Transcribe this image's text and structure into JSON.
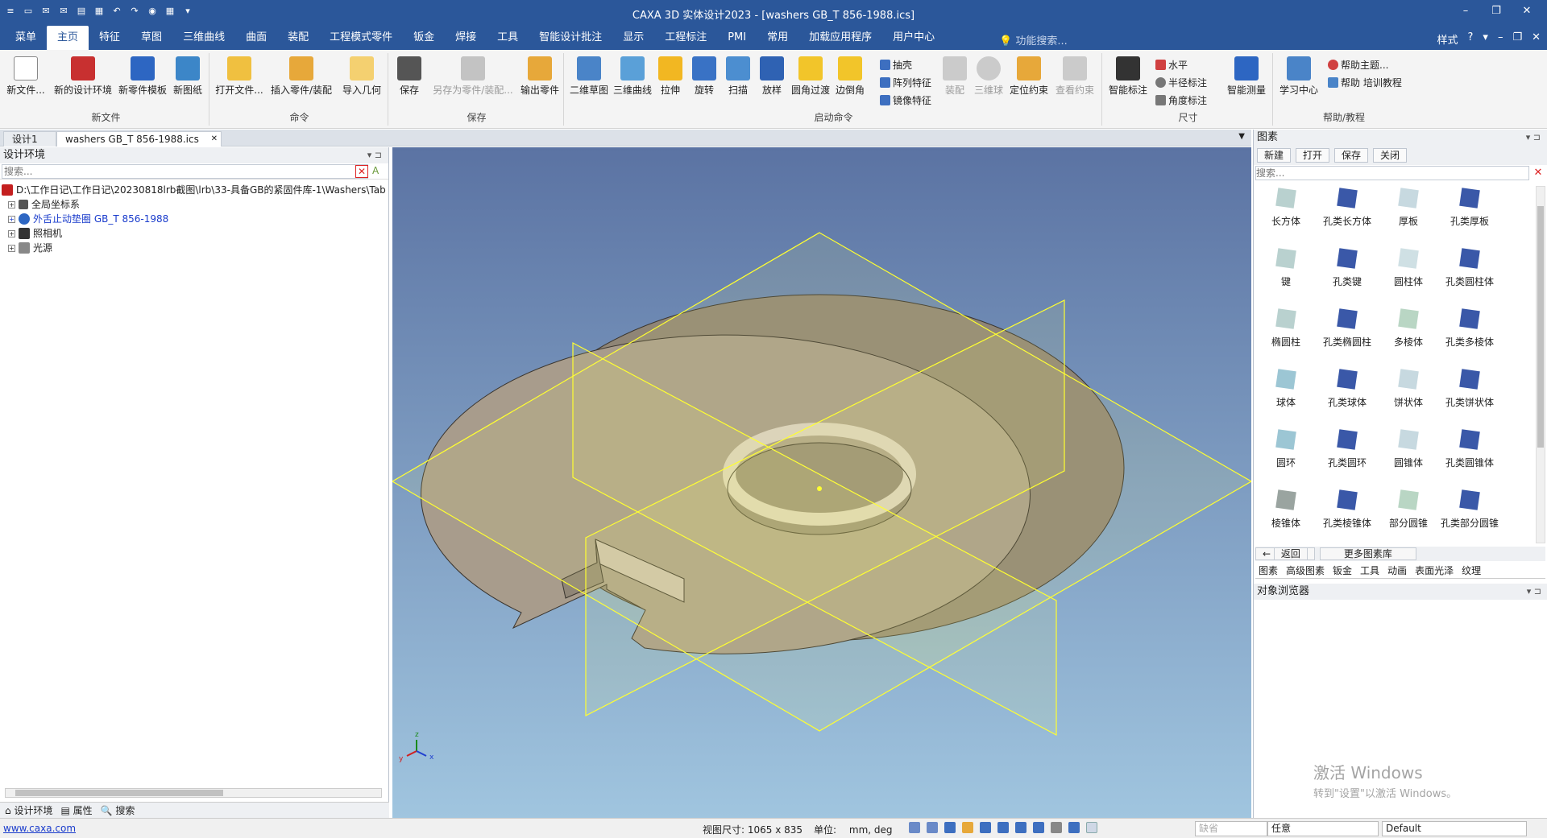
{
  "window": {
    "title": "CAXA 3D 实体设计2023 - [washers GB_T 856-1988.ics]",
    "minimize": "–",
    "restore": "❐",
    "close": "✕"
  },
  "quick_access": [
    "≡",
    "▭",
    "✉",
    "✉",
    "▤",
    "▦",
    "↶",
    "↷",
    "◉",
    "▦",
    "▾"
  ],
  "menu": {
    "tabs": [
      "菜单",
      "主页",
      "特征",
      "草图",
      "三维曲线",
      "曲面",
      "装配",
      "工程模式零件",
      "钣金",
      "焊接",
      "工具",
      "智能设计批注",
      "显示",
      "工程标注",
      "PMI",
      "常用",
      "加载应用程序",
      "用户中心"
    ],
    "search_placeholder": "功能搜索...",
    "style_label": "样式",
    "help": "?",
    "icons": [
      "▾",
      "–",
      "❐",
      "✕"
    ]
  },
  "ribbon": {
    "groups": {
      "new": "新文件",
      "cmd": "命令",
      "save": "保存",
      "launch": "启动命令",
      "dim": "尺寸",
      "help": "帮助/教程"
    },
    "new": [
      "新文件...",
      "新的设计环境",
      "新零件模板",
      "新图纸"
    ],
    "cmd": [
      "打开文件...",
      "插入零件/装配",
      "导入几何"
    ],
    "save": [
      "保存",
      "另存为零件/装配...",
      "输出零件"
    ],
    "launch": [
      "二维草图",
      "三维曲线",
      "拉伸",
      "旋转",
      "扫描",
      "放样",
      "圆角过渡",
      "边倒角"
    ],
    "launch_small": [
      "抽壳",
      "阵列特征",
      "镜像特征"
    ],
    "launch_dis": [
      "装配",
      "三维球",
      "定位约束",
      "查看约束"
    ],
    "dim": [
      "智能标注"
    ],
    "dim_small": [
      "水平",
      "半径标注",
      "角度标注"
    ],
    "dim_measure": "智能测量",
    "help": [
      "学习中心"
    ],
    "help_small": [
      "帮助主题...",
      "帮助 培训教程"
    ]
  },
  "doctabs": [
    "设计1",
    "washers GB_T 856-1988.ics"
  ],
  "doctab_close": "✕",
  "left": {
    "title": "设计环境",
    "search_placeholder": "搜索...",
    "tree": [
      {
        "label": "D:\\工作日记\\工作日记\\20230818lrb截图\\lrb\\33-具备GB的紧固件库-1\\Washers\\Tab",
        "color": "#c41f1f"
      },
      {
        "label": "全局坐标系",
        "color": "#444"
      },
      {
        "label": "外舌止动垫圈 GB_T 856-1988",
        "color": "#1a3ccc"
      },
      {
        "label": "照相机",
        "color": "#444"
      },
      {
        "label": "光源",
        "color": "#444"
      }
    ],
    "tabs": [
      "设计环境",
      "属性",
      "搜索"
    ]
  },
  "viewport": {
    "axis_z": "z",
    "axis_y": "y",
    "axis_x": "x"
  },
  "right": {
    "title": "图素",
    "toolbar": [
      "新建",
      "打开",
      "保存",
      "关闭"
    ],
    "search_placeholder": "搜索...",
    "items": [
      "长方体",
      "孔类长方体",
      "厚板",
      "孔类厚板",
      "键",
      "孔类键",
      "圆柱体",
      "孔类圆柱体",
      "椭圆柱",
      "孔类椭圆柱",
      "多棱体",
      "孔类多棱体",
      "球体",
      "孔类球体",
      "饼状体",
      "孔类饼状体",
      "圆环",
      "孔类圆环",
      "圆锥体",
      "孔类圆锥体",
      "棱锥体",
      "孔类棱锥体",
      "部分圆锥",
      "孔类部分圆锥"
    ],
    "nav": [
      "返回",
      "更多图素库"
    ],
    "tabs": [
      "图素",
      "高级图素",
      "钣金",
      "工具",
      "动画",
      "表面光泽",
      "纹理"
    ],
    "object_browser": "对象浏览器"
  },
  "watermark": {
    "line1": "激活 Windows",
    "line2": "转到\"设置\"以激活 Windows。"
  },
  "status": {
    "site": "www.caxa.com",
    "view_size": "视图尺寸: 1065 x  835",
    "unit_label": "单位:",
    "unit_value": "mm, deg",
    "combo1": "缺省",
    "combo2": "任意",
    "combo3": "Default"
  },
  "colors": {
    "accent": "#2b579a",
    "washer": "#a89c8c",
    "guide": "#ffff30"
  }
}
